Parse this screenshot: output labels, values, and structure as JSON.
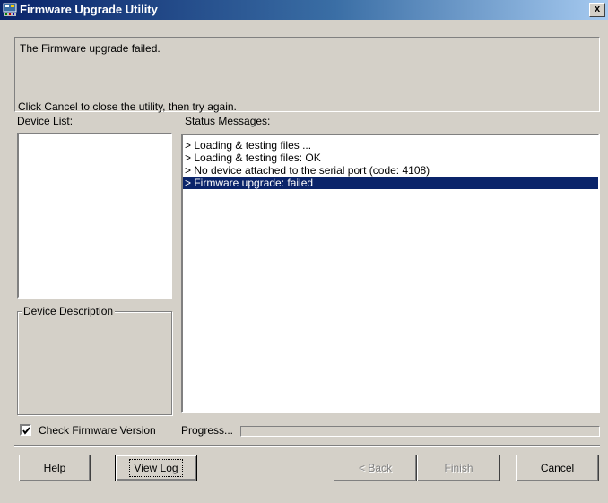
{
  "window": {
    "title": "Firmware Upgrade Utility",
    "close_label": "x"
  },
  "message": {
    "line1": "The Firmware upgrade failed.",
    "line2": "Click Cancel to close the utility, then try again."
  },
  "device_list": {
    "label": "Device List:"
  },
  "status": {
    "label": "Status Messages:",
    "lines": [
      "> Loading & testing files ...",
      "> Loading & testing files: OK",
      "> No device attached to the serial port (code: 4108)",
      "> Firmware upgrade: failed"
    ],
    "selected_index": 3
  },
  "device_description": {
    "label": "Device Description"
  },
  "check_firmware": {
    "label": "Check Firmware Version",
    "checked": true
  },
  "progress": {
    "label": "Progress...",
    "value": 0
  },
  "buttons": {
    "help": "Help",
    "view_log": "View Log",
    "back": "< Back",
    "finish": "Finish",
    "cancel": "Cancel"
  },
  "colors": {
    "titlebar": "#0a246a",
    "selection": "#0a246a",
    "face": "#d4d0c8"
  }
}
